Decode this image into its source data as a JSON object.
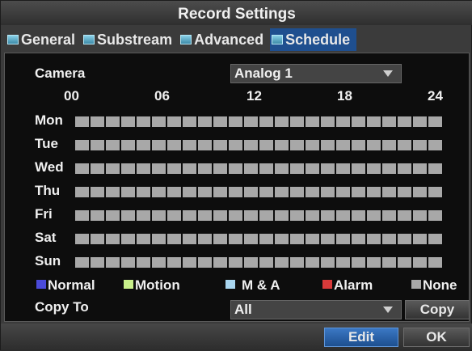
{
  "title": "Record Settings",
  "tabs": [
    {
      "label": "General",
      "active": false
    },
    {
      "label": "Substream",
      "active": false
    },
    {
      "label": "Advanced",
      "active": false
    },
    {
      "label": "Schedule",
      "active": true
    }
  ],
  "camera": {
    "label": "Camera",
    "selected": "Analog 1"
  },
  "hours": [
    "00",
    "06",
    "12",
    "18",
    "24"
  ],
  "days": [
    "Mon",
    "Tue",
    "Wed",
    "Thu",
    "Fri",
    "Sat",
    "Sun"
  ],
  "slots_per_day": 24,
  "slot_color": "#a8a8a8",
  "legend": [
    {
      "label": "Normal",
      "color": "#4a4ad8"
    },
    {
      "label": "Motion",
      "color": "#c8f08a"
    },
    {
      "label": "M & A",
      "color": "#a9d6f0"
    },
    {
      "label": "Alarm",
      "color": "#d83a3a"
    },
    {
      "label": "None",
      "color": "#a8a8a8"
    }
  ],
  "copy": {
    "label": "Copy To",
    "selected": "All",
    "button": "Copy"
  },
  "footer": {
    "edit": "Edit",
    "ok": "OK"
  }
}
